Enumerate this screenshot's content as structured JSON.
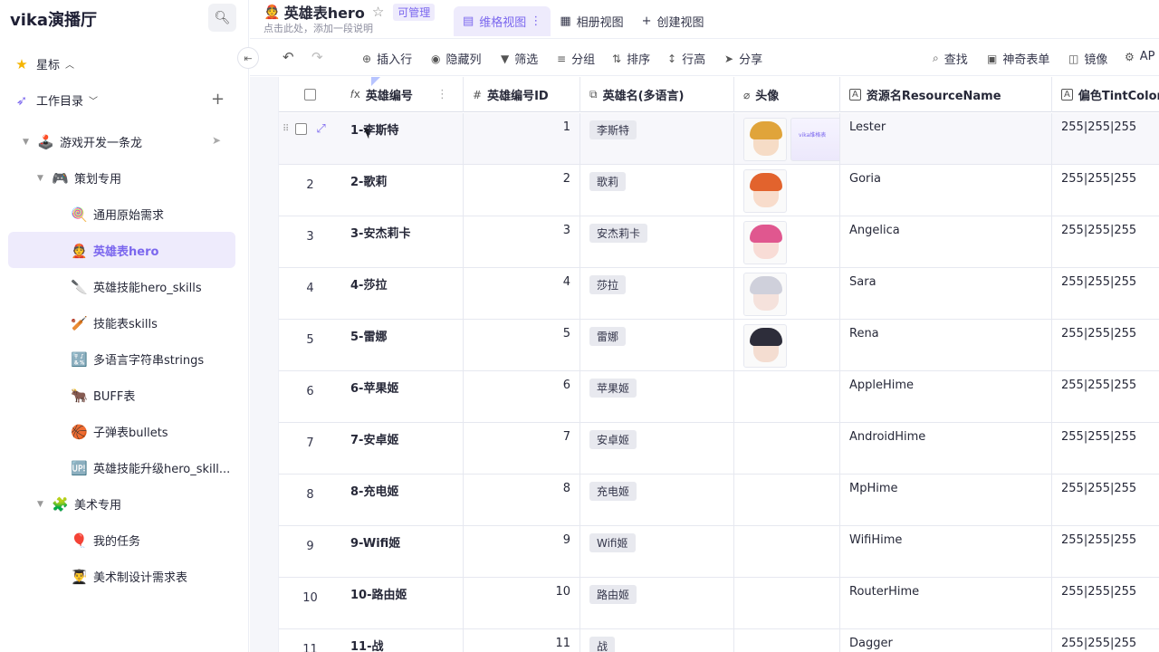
{
  "sidebar": {
    "brand": "vika演播厅",
    "starred": "星标",
    "catalog": "工作目录",
    "items": [
      {
        "emoji": "🕹️",
        "label": "游戏开发一条龙"
      },
      {
        "emoji": "🎮",
        "label": "策划专用"
      },
      {
        "emoji": "🍭",
        "label": "通用原始需求"
      },
      {
        "emoji": "👲",
        "label": "英雄表hero"
      },
      {
        "emoji": "🔪",
        "label": "英雄技能hero_skills"
      },
      {
        "emoji": "🏏",
        "label": "技能表skills"
      },
      {
        "emoji": "🔣",
        "label": "多语言字符串strings"
      },
      {
        "emoji": "🐂",
        "label": "BUFF表"
      },
      {
        "emoji": "🏀",
        "label": "子弹表bullets"
      },
      {
        "emoji": "🆙",
        "label": "英雄技能升级hero_skill..."
      },
      {
        "emoji": "🧩",
        "label": "美术专用"
      },
      {
        "emoji": "🎈",
        "label": "我的任务"
      },
      {
        "emoji": "👨‍🎓",
        "label": "美术制设计需求表"
      }
    ]
  },
  "header": {
    "emoji": "👲",
    "title": "英雄表hero",
    "permission": "可管理",
    "subtitle": "点击此处，添加一段说明",
    "tabs": [
      {
        "label": "维格视图",
        "icon": "grid-icon"
      },
      {
        "label": "相册视图",
        "icon": "gallery-icon"
      },
      {
        "label": "创建视图",
        "icon": "plus-icon"
      }
    ]
  },
  "toolbar": {
    "insert_row": "插入行",
    "hide_cols": "隐藏列",
    "filter": "筛选",
    "group": "分组",
    "sort": "排序",
    "row_height": "行高",
    "share": "分享",
    "find": "查找",
    "form": "神奇表单",
    "mirror": "镜像",
    "api": "AP"
  },
  "columns": [
    {
      "label": "英雄编号",
      "icon": "𝑓x"
    },
    {
      "label": "英雄编号ID",
      "icon": "#"
    },
    {
      "label": "英雄名(多语言)",
      "icon": "⧉"
    },
    {
      "label": "头像",
      "icon": "🔗"
    },
    {
      "label": "资源名ResourceName",
      "icon": "A"
    },
    {
      "label": "偏色TintColor",
      "icon": "A"
    }
  ],
  "rows": [
    {
      "idx": "1",
      "name": "1-李斯特",
      "id": "1",
      "tag": "李斯特",
      "res": "Lester",
      "tint": "255|255|255"
    },
    {
      "idx": "2",
      "name": "2-歌莉",
      "id": "2",
      "tag": "歌莉",
      "res": "Goria",
      "tint": "255|255|255"
    },
    {
      "idx": "3",
      "name": "3-安杰莉卡",
      "id": "3",
      "tag": "安杰莉卡",
      "res": "Angelica",
      "tint": "255|255|255"
    },
    {
      "idx": "4",
      "name": "4-莎拉",
      "id": "4",
      "tag": "莎拉",
      "res": "Sara",
      "tint": "255|255|255"
    },
    {
      "idx": "5",
      "name": "5-雷娜",
      "id": "5",
      "tag": "雷娜",
      "res": "Rena",
      "tint": "255|255|255"
    },
    {
      "idx": "6",
      "name": "6-苹果姬",
      "id": "6",
      "tag": "苹果姬",
      "res": "AppleHime",
      "tint": "255|255|255"
    },
    {
      "idx": "7",
      "name": "7-安卓姬",
      "id": "7",
      "tag": "安卓姬",
      "res": "AndroidHime",
      "tint": "255|255|255"
    },
    {
      "idx": "8",
      "name": "8-充电姬",
      "id": "8",
      "tag": "充电姬",
      "res": "MpHime",
      "tint": "255|255|255"
    },
    {
      "idx": "9",
      "name": "9-Wifi姬",
      "id": "9",
      "tag": "Wifi姬",
      "res": "WifiHime",
      "tint": "255|255|255"
    },
    {
      "idx": "10",
      "name": "10-路由姬",
      "id": "10",
      "tag": "路由姬",
      "res": "RouterHime",
      "tint": "255|255|255"
    },
    {
      "idx": "11",
      "name": "11-战",
      "id": "11",
      "tag": "战",
      "res": "Dagger",
      "tint": "255|255|255"
    }
  ],
  "thumb_text": "vika维格表",
  "colors": {
    "accent": "#7b67ee",
    "active_bg": "#eeebfc"
  }
}
